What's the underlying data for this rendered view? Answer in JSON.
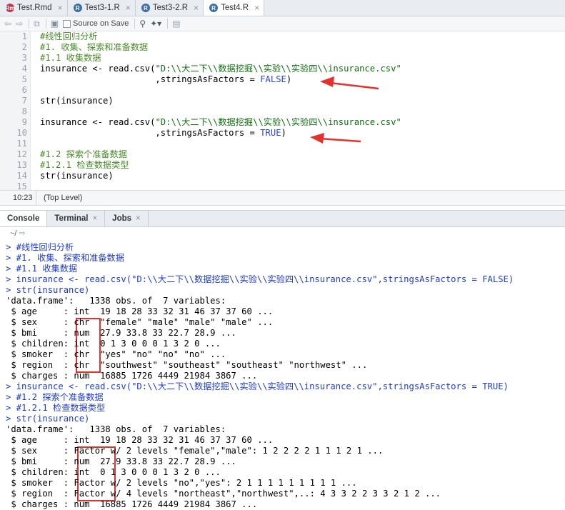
{
  "editor_tabs": [
    {
      "label": "Test.Rmd",
      "type": "Rmd",
      "active": false
    },
    {
      "label": "Test3-1.R",
      "type": "R",
      "active": false
    },
    {
      "label": "Test3-2.R",
      "type": "R",
      "active": false
    },
    {
      "label": "Test4.R",
      "type": "R",
      "active": true
    }
  ],
  "toolbar": {
    "source_on_save_label": "Source on Save"
  },
  "editor_lines": [
    {
      "num": "1",
      "text": "#线性回归分析"
    },
    {
      "num": "2",
      "text": "#1. 收集、探索和准备数据"
    },
    {
      "num": "3",
      "text": "#1.1 收集数据"
    },
    {
      "num": "4",
      "text": "insurance <- read.csv(\"D:\\\\大二下\\\\数据挖掘\\\\实验\\\\实验四\\\\insurance.csv\""
    },
    {
      "num": "5",
      "text": "                      ,stringsAsFactors = FALSE)"
    },
    {
      "num": "6",
      "text": ""
    },
    {
      "num": "7",
      "text": "str(insurance)"
    },
    {
      "num": "8",
      "text": ""
    },
    {
      "num": "9",
      "text": "insurance <- read.csv(\"D:\\\\大二下\\\\数据挖掘\\\\实验\\\\实验四\\\\insurance.csv\""
    },
    {
      "num": "10",
      "text": "                      ,stringsAsFactors = TRUE)"
    },
    {
      "num": "11",
      "text": ""
    },
    {
      "num": "12",
      "text": "#1.2 探索个准备数据"
    },
    {
      "num": "13",
      "text": "#1.2.1 检查数据类型"
    },
    {
      "num": "14",
      "text": "str(insurance)"
    },
    {
      "num": "15",
      "text": ""
    }
  ],
  "status": {
    "cursor_pos": "10:23",
    "scope": "(Top Level)"
  },
  "console_tabs": [
    {
      "label": "Console",
      "active": true
    },
    {
      "label": "Terminal",
      "active": false
    },
    {
      "label": "Jobs",
      "active": false
    }
  ],
  "console_path": "~/",
  "console_lines": [
    {
      "kind": "in",
      "text": "> #线性回归分析"
    },
    {
      "kind": "in",
      "text": "> #1. 收集、探索和准备数据"
    },
    {
      "kind": "in",
      "text": "> #1.1 收集数据"
    },
    {
      "kind": "in",
      "text": "> insurance <- read.csv(\"D:\\\\大二下\\\\数据挖掘\\\\实验\\\\实验四\\\\insurance.csv\",stringsAsFactors = FALSE)"
    },
    {
      "kind": "in",
      "text": "> str(insurance)"
    },
    {
      "kind": "out",
      "text": "'data.frame':   1338 obs. of  7 variables:"
    },
    {
      "kind": "out",
      "text": " $ age     : int  19 18 28 33 32 31 46 37 37 60 ..."
    },
    {
      "kind": "out",
      "text": " $ sex     : chr  \"female\" \"male\" \"male\" \"male\" ..."
    },
    {
      "kind": "out",
      "text": " $ bmi     : num  27.9 33.8 33 22.7 28.9 ..."
    },
    {
      "kind": "out",
      "text": " $ children: int  0 1 3 0 0 0 1 3 2 0 ..."
    },
    {
      "kind": "out",
      "text": " $ smoker  : chr  \"yes\" \"no\" \"no\" \"no\" ..."
    },
    {
      "kind": "out",
      "text": " $ region  : chr  \"southwest\" \"southeast\" \"southeast\" \"northwest\" ..."
    },
    {
      "kind": "out",
      "text": " $ charges : num  16885 1726 4449 21984 3867 ..."
    },
    {
      "kind": "in",
      "text": "> insurance <- read.csv(\"D:\\\\大二下\\\\数据挖掘\\\\实验\\\\实验四\\\\insurance.csv\",stringsAsFactors = TRUE)"
    },
    {
      "kind": "in",
      "text": "> #1.2 探索个准备数据"
    },
    {
      "kind": "in",
      "text": "> #1.2.1 检查数据类型"
    },
    {
      "kind": "in",
      "text": "> str(insurance)"
    },
    {
      "kind": "out",
      "text": "'data.frame':   1338 obs. of  7 variables:"
    },
    {
      "kind": "out",
      "text": " $ age     : int  19 18 28 33 32 31 46 37 37 60 ..."
    },
    {
      "kind": "out",
      "text": " $ sex     : Factor w/ 2 levels \"female\",\"male\": 1 2 2 2 2 1 1 1 2 1 ..."
    },
    {
      "kind": "out",
      "text": " $ bmi     : num  27.9 33.8 33 22.7 28.9 ..."
    },
    {
      "kind": "out",
      "text": " $ children: int  0 1 3 0 0 0 1 3 2 0 ..."
    },
    {
      "kind": "out",
      "text": " $ smoker  : Factor w/ 2 levels \"no\",\"yes\": 2 1 1 1 1 1 1 1 1 1 ..."
    },
    {
      "kind": "out",
      "text": " $ region  : Factor w/ 4 levels \"northeast\",\"northwest\",..: 4 3 3 2 2 3 3 2 1 2 ..."
    },
    {
      "kind": "out",
      "text": " $ charges : num  16885 1726 4449 21984 3867 ..."
    }
  ],
  "colors": {
    "annotation": "#e5312e",
    "console_input": "#1e3bd1",
    "comment": "#4a8a2a",
    "string": "#0f6e0f",
    "keyword": "#2b46d6"
  }
}
